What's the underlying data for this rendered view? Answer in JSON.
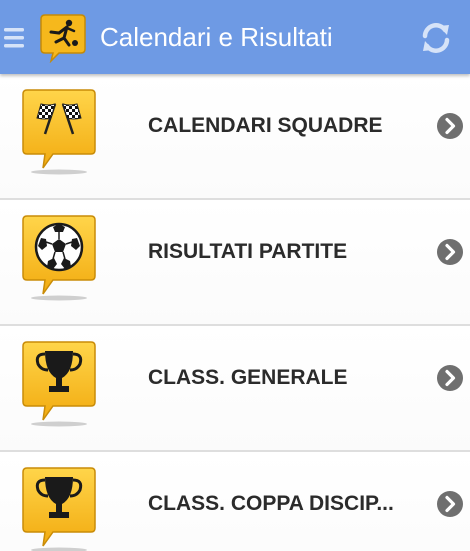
{
  "header": {
    "title": "Calendari e Risultati",
    "menu_icon": "hamburger-menu-icon",
    "logo_icon": "soccer-player-icon",
    "refresh_icon": "refresh-icon",
    "color": "#6e9ae4"
  },
  "menu": {
    "items": [
      {
        "label": "CALENDARI SQUADRE",
        "icon": "checkered-flags-icon",
        "arrow_icon": "chevron-right-circle-icon"
      },
      {
        "label": "RISULTATI PARTITE",
        "icon": "soccer-ball-icon",
        "arrow_icon": "chevron-right-circle-icon"
      },
      {
        "label": "CLASS. GENERALE",
        "icon": "trophy-icon",
        "arrow_icon": "chevron-right-circle-icon"
      },
      {
        "label": "CLASS. COPPA DISCIP...",
        "icon": "trophy-icon",
        "arrow_icon": "chevron-right-circle-icon"
      }
    ],
    "icon_color": "#f4b41a"
  }
}
